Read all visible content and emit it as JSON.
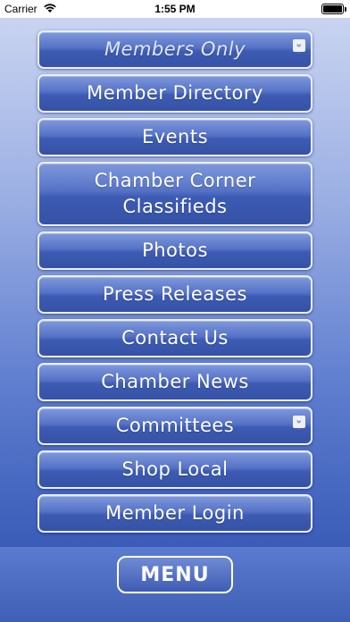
{
  "status_bar": {
    "carrier": "Carrier",
    "time": "1:55 PM"
  },
  "menu": {
    "items": [
      {
        "label": "Members Only",
        "has_submenu": true
      },
      {
        "label": "Member Directory"
      },
      {
        "label": "Events"
      },
      {
        "label": "Chamber Corner Classifieds"
      },
      {
        "label": "Photos"
      },
      {
        "label": "Press Releases"
      },
      {
        "label": "Contact Us"
      },
      {
        "label": "Chamber News"
      },
      {
        "label": "Committees",
        "has_submenu": true
      },
      {
        "label": "Shop Local"
      },
      {
        "label": "Member Login"
      }
    ],
    "toggle_label": "MENU"
  },
  "colors": {
    "button_border": "#e9eefc",
    "button_fill": "#4a68bd",
    "background_bottom": "#2f4f9e"
  },
  "icons": {
    "submenu": "double-chevron-down-icon",
    "wifi": "wifi-icon",
    "battery": "battery-icon"
  }
}
